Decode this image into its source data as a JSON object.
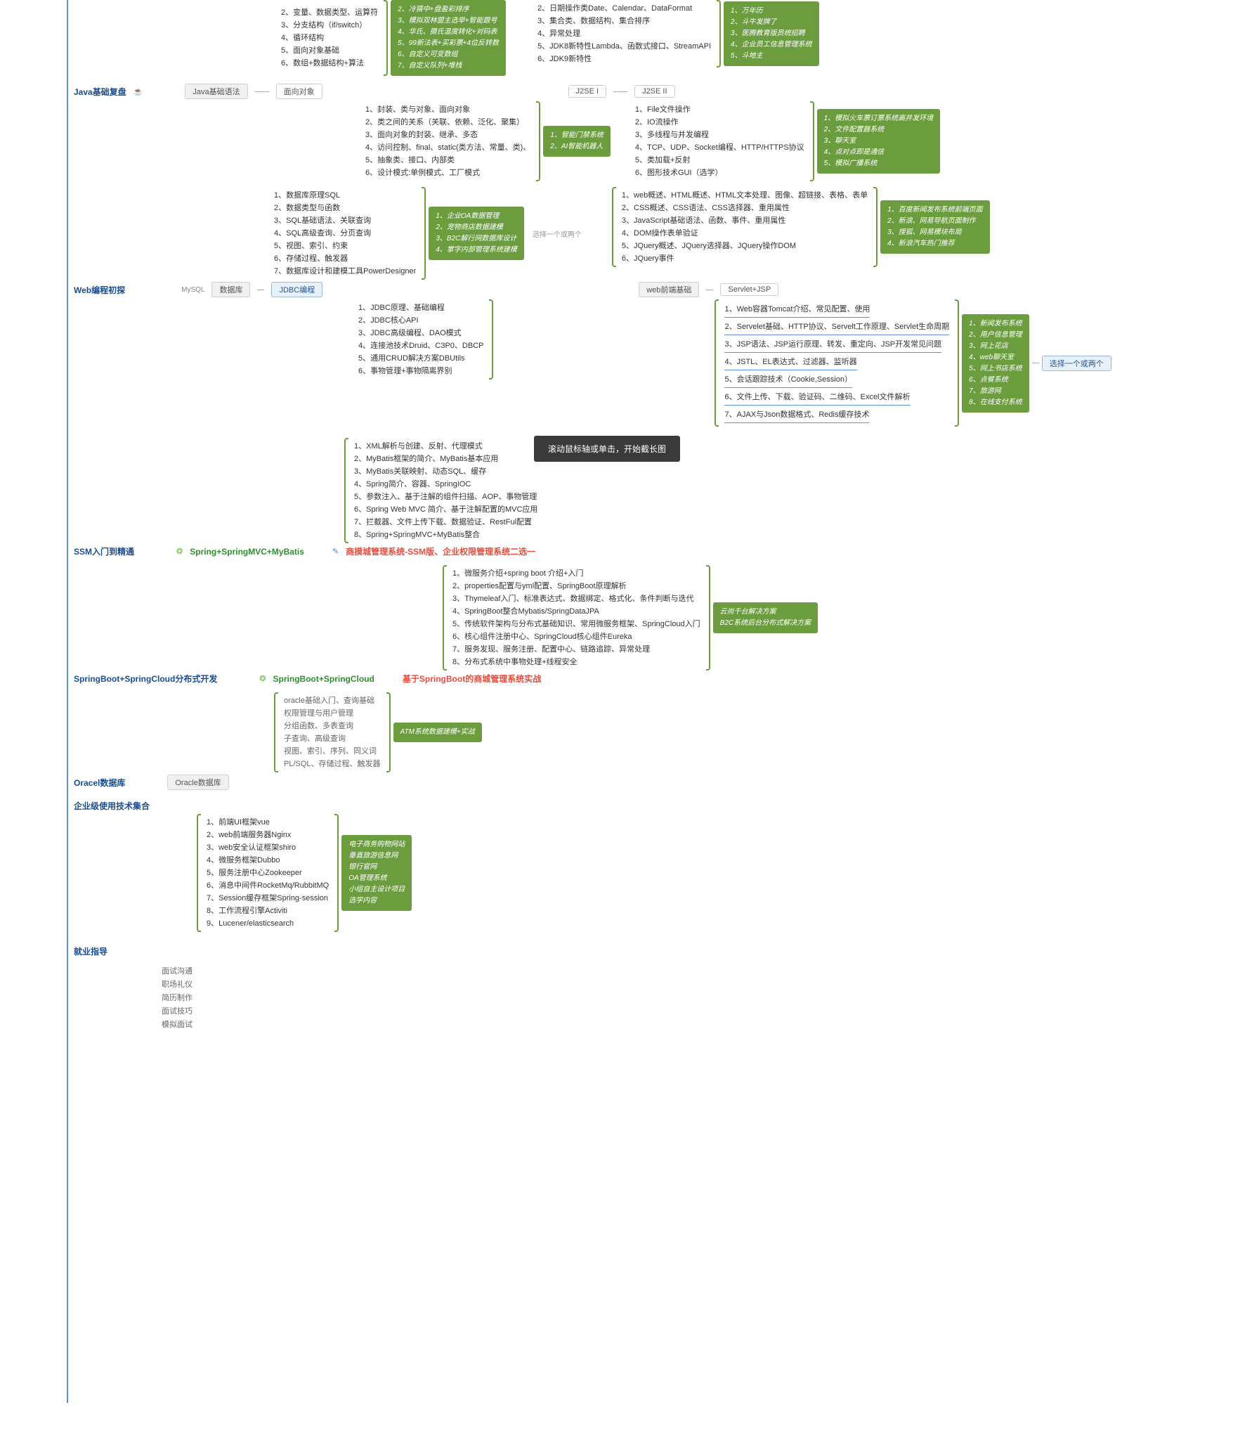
{
  "top": {
    "colA": [
      "2、变量、数据类型、运算符",
      "3、分支结构（if/switch）",
      "4、循环结构",
      "5、面向对象基础",
      "6、数组+数据结构+算法"
    ],
    "boxA": [
      "2、冷猜中+盘盈彩排序",
      "3、模拟双林盟主选举+智能跟号",
      "4、华氏、摄氏温度转化+对码表",
      "5、99新法表+买彩票+4位反转数",
      "6、自定义可变数组",
      "7、自定义队列+堆栈"
    ],
    "colB": [
      "2、日期操作类Date、Calendar、DataFormat",
      "3、集合类、数据结构、集合排序",
      "4、异常处理",
      "5、JDK8新特性Lambda、函数式接口、StreamAPI",
      "6、JDK9新特性"
    ],
    "boxB": [
      "1、万年历",
      "2、斗牛发牌了",
      "3、医腾教育版员统招聘",
      "4、企业员工信息管理系统",
      "5、斗地主"
    ]
  },
  "s1": {
    "title": "Java基础复盘",
    "p1": "Java基础语法",
    "p2": "面向对象",
    "p3": "J2SE I",
    "p4": "J2SE II",
    "colA": [
      "1、封装、类与对象、面向对象",
      "2、类之间的关系（关联、依赖、泛化、聚集）",
      "3、面向对象的封装、继承、多态",
      "4、访问控制、final、static(类方法、常量、类)、",
      "5、抽象类、接口、内部类",
      "6、设计模式:单例模式、工厂模式"
    ],
    "boxA": [
      "1、智能门禁系统",
      "2、AI智能机器人"
    ],
    "colB": [
      "1、File文件操作",
      "2、IO流操作",
      "3、多线程与并发编程",
      "4、TCP、UDP、Socket编程、HTTP/HTTPS协议",
      "5、类加载+反射",
      "6、图形技术GUI（选学）"
    ],
    "boxB": [
      "1、模拟火车票订票系统高并发环境",
      "2、文件配置器系统",
      "3、聊天室",
      "4、点对点即是通信",
      "5、模拟广播系统"
    ]
  },
  "s2": {
    "colA": [
      "1、数据库原理SQL",
      "2、数据类型与函数",
      "3、SQL基础语法、关联查询",
      "4、SQL高级查询、分页查询",
      "5、视图、索引、约束",
      "6、存储过程、触发器",
      "7、数据库设计和建模工具PowerDesigner"
    ],
    "boxA": [
      "1、企业OA数据管理",
      "2、宠物商店数据建模",
      "3、B2C解行网数据库设计",
      "4、掌字内部管理系统建模"
    ],
    "note1": "选择一个或两个",
    "colB": [
      "1、web概述、HTML概述、HTML文本处理、图像、超链接、表格、表单",
      "2、CSS概述、CSS语法、CSS选择器、重用属性",
      "3、JavaScript基础语法、函数、事件、重用属性",
      "4、DOM操作表单验证",
      "5、JQuery概述、JQuery选择器、JQuery操作DOM",
      "6、JQuery事件"
    ],
    "boxB": [
      "1、百度新闻发布系统前端页面",
      "2、新浪、网易导航页面制作",
      "3、搜狐、网易模块布局",
      "4、新浪汽车热门推荐"
    ]
  },
  "s3": {
    "title": "Web编程初探",
    "mysql": "MySQL",
    "p1": "数据库",
    "p2": "JDBC编程",
    "p3": "web前端基础",
    "p4": "Servlet+JSP",
    "colA": [
      "1、JDBC原理、基础编程",
      "2、JDBC核心API",
      "3、JDBC高级编程、DAO模式",
      "4、连接池技术Druid、C3P0、DBCP",
      "5、通用CRUD解决方案DBUtils",
      "6、事物管理+事物隔离界别"
    ],
    "colB": [
      "1、Web容器Tomcat介绍、常见配置、使用",
      "2、Servelet基础、HTTP协议、Servelt工作原理、Servlet生命周期",
      "3、JSP语法、JSP运行原理、转发、重定向、JSP开发常见问题",
      "4、JSTL、EL表达式、过滤器、监听器",
      "5、会话跟踪技术（Cookie,Session）",
      "6、文件上传、下载、验证码、二维码、Excel文件解析",
      "7、AJAX与Json数据格式、Redis缓存技术"
    ],
    "boxB": [
      "1、新闻发布系统",
      "2、用户信息管理",
      "3、网上花店",
      "4、web聊天室",
      "5、网上书店系统",
      "6、点餐系统",
      "7、旅游网",
      "8、在线支付系统"
    ],
    "note2": "选择一个或两个"
  },
  "s4": {
    "list": [
      "1、XML解析与创建、反射、代理模式",
      "2、MyBatis框架的简介、MyBatis基本应用",
      "3、MyBatis关联映射、动态SQL、缓存",
      "4、Spring简介、容器、SpringIOC",
      "5、参数注入、基于注解的组件扫描、AOP、事物管理",
      "6、Spring Web MVC 简介、基于注解配置的MVC应用",
      "7、拦截器、文件上传下载、数据验证、RestFul配置",
      "8、Spring+SpringMVC+MyBatis整合"
    ]
  },
  "s5": {
    "title": "SSM入门到精通",
    "p1": "Spring+SpringMVC+MyBatis",
    "p2": "商摸城管理系统-SSM版、企业权限管理系统二选一"
  },
  "s6": {
    "list": [
      "1、微服务介绍+spring boot 介绍+入门",
      "2、properties配置与yml配置、SpringBoot原理解析",
      "3、Thymeleaf入门、标准表达式、数据绑定、格式化、条件判断与迭代",
      "4、SpringBoot整合Mybatis/SpringDataJPA",
      "5、传统软件架构与分布式基础知识、常用微服务框架、SpringCloud入门",
      "6、核心组件注册中心、SpringCloud核心组件Eureka",
      "7、服务发现、服务注册、配置中心、链路追踪、异常处理",
      "8、分布式系统中事物处理+线程安全"
    ],
    "box": [
      "云尚千台解决方案",
      "B2C系统后台分布式解决方案"
    ]
  },
  "s7": {
    "title": "SpringBoot+SpringCloud分布式开发",
    "p1": "SpringBoot+SpringCloud",
    "p2": "基于SpringBoot的商城管理系统实战"
  },
  "s8": {
    "list": [
      "oracle基础入门、查询基础",
      "权限管理与用户管理",
      "分组函数、多表查询",
      "子查询、高级查询",
      "视图、索引、序列、同义词",
      "PL/SQL、存储过程、触发器"
    ],
    "box": "ATM系统数据建模+实战"
  },
  "s9": {
    "title": "Oracel数据库",
    "p1": "Oracle数据库"
  },
  "s10": {
    "title": "企业级使用技术集合",
    "list": [
      "1、前端UI框架vue",
      "2、web前端服务器Nginx",
      "3、web安全认证框架shiro",
      "4、微服务框架Dubbo",
      "5、服务注册中心Zookeeper",
      "6、消息中间件RocketMq/RubbitMQ",
      "7、Session缓存框架Spring-session",
      "8、工作流程引擎Activiti",
      "9、Lucener/elasticsearch"
    ],
    "box": [
      "电子商务购物网站",
      "垂直旅游信息网",
      "银行官网",
      "OA管理系统",
      "小组自主设计项目",
      "选学内容"
    ]
  },
  "s11": {
    "title": "就业指导",
    "list": [
      "面试沟通",
      "职场礼仪",
      "简历制作",
      "面试技巧",
      "模拟面试"
    ]
  },
  "tooltip": "滚动鼠标轴或单击，开始截长图"
}
